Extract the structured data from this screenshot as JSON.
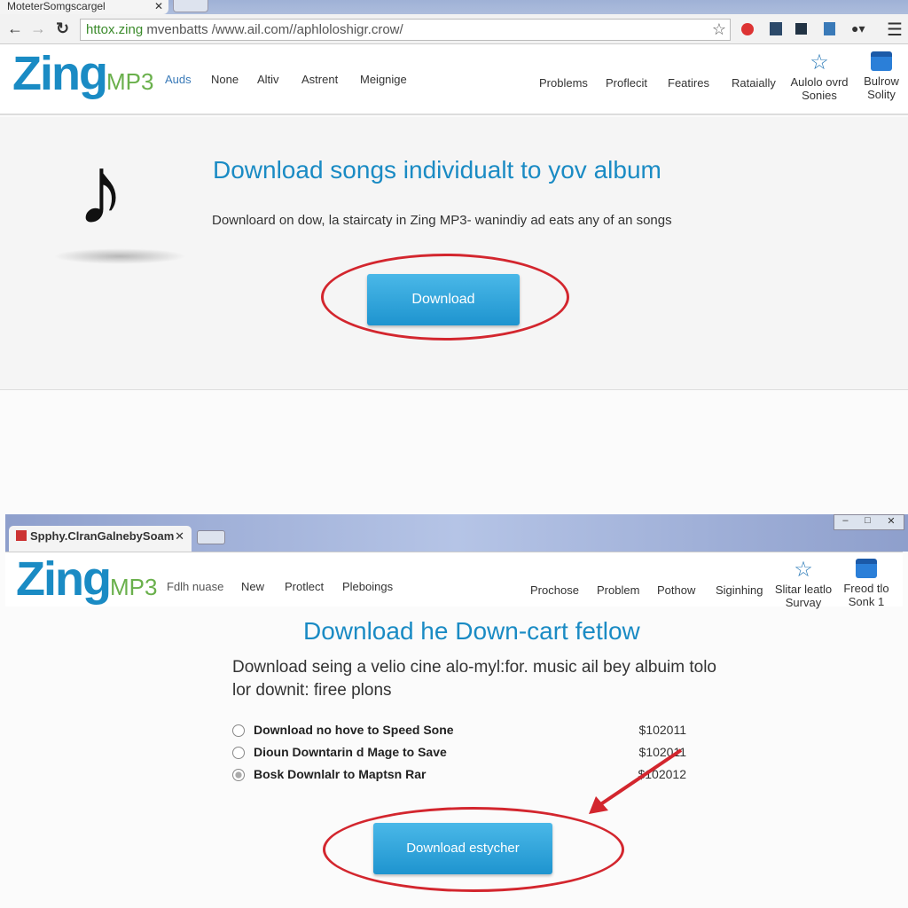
{
  "browser1": {
    "tab_title": "MoteterSomgscargel",
    "url_host": "httox.zing",
    "url_rest": " mvenbatts /www.ail.com//aphloloshigr.crow/"
  },
  "site1": {
    "logo_main": "Zing",
    "logo_sub": "MP3",
    "nav_left": [
      "Auds",
      "None",
      "Altiv",
      "Astrent",
      "Meignige"
    ],
    "nav_right": [
      "Problems",
      "Proflecit",
      "Featires",
      "Rataially"
    ],
    "nav_icon_items": [
      {
        "line1": "Aulolo ovrd",
        "line2": "Sonies",
        "icon": "star-icon"
      },
      {
        "line1": "Bulrow",
        "line2": "Solity",
        "icon": "window-icon"
      }
    ],
    "heading": "Download songs individualt to yov album",
    "description": "Downloard on dow, la staircaty in Zing MP3- wanindiy ad eats any of an songs",
    "download_button": "Download"
  },
  "browser2": {
    "tab_title": "Spphy.ClranGalnebySoam"
  },
  "site2": {
    "logo_main": "Zing",
    "logo_sub": "MP3",
    "nav_left": [
      "Fdlh nuase",
      "New",
      "Protlect",
      "Pleboings"
    ],
    "nav_right": [
      "Prochose",
      "Problem",
      "Pothow",
      "Siginhing"
    ],
    "nav_icon_items": [
      {
        "line1": "Slitar leatlo",
        "line2": "Survay",
        "icon": "star-icon"
      },
      {
        "line1": "Freod tlo",
        "line2": "Sonk 1",
        "icon": "window-icon"
      }
    ],
    "heading": "Download he Down-cart fetlow",
    "description_line1": "Download seing a velio cine alo-myl:for. music ail bey albuim tolo",
    "description_line2": "lor downit: firee plons",
    "options": [
      {
        "label": "Download no hove to Speed Sone",
        "price": "$102011",
        "selected": false
      },
      {
        "label": "Dioun Downtarin d Mage to Save",
        "price": "$102011",
        "selected": false
      },
      {
        "label": "Bosk Downlalr to Maptsn Rar",
        "price": "$102012",
        "selected": true
      }
    ],
    "download_button": "Download estycher"
  },
  "colors": {
    "brand_blue": "#1a8bc4",
    "brand_green": "#6ab04c",
    "annotation_red": "#d3262e"
  }
}
